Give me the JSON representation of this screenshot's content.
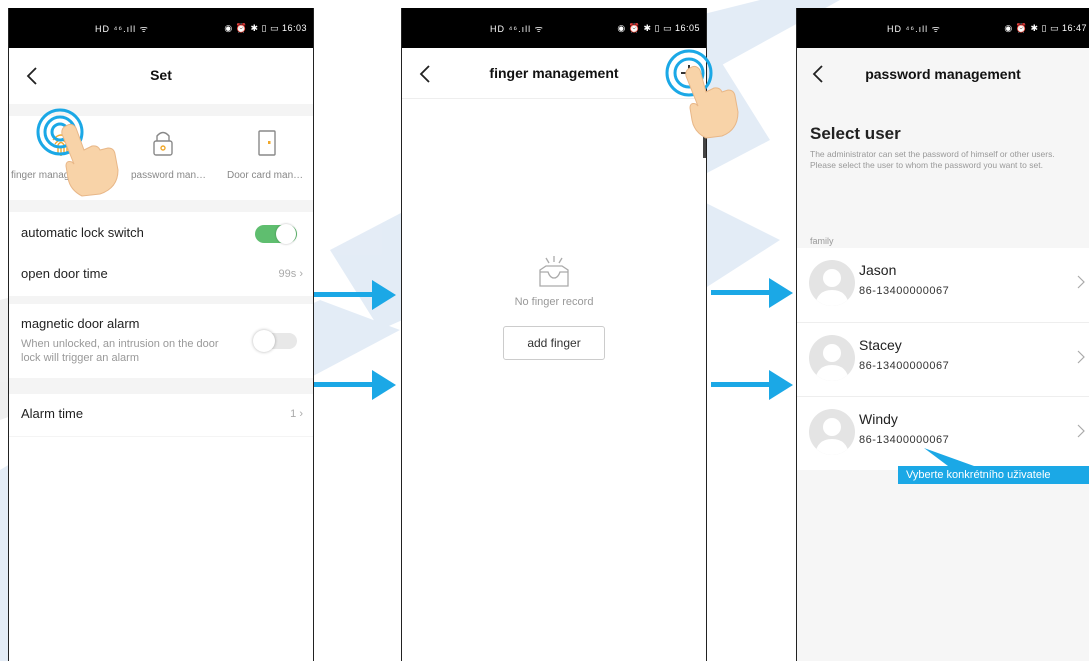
{
  "colors": {
    "accent": "#1ba8e6",
    "toggle_on": "#5fbe6f",
    "watermark": "#dce9f7"
  },
  "screen1": {
    "status_left": "HD ⁴⁶.ıll ᯤ",
    "status_right": "◉ ⏰ ✱ ▯ ▭ 16:03",
    "title": "Set",
    "icons": [
      {
        "label": "finger management",
        "icon": "fingerprint-icon"
      },
      {
        "label": "password management",
        "icon": "lock-icon"
      },
      {
        "label": "Door card management",
        "icon": "door-card-icon"
      }
    ],
    "automatic_lock": {
      "label": "automatic lock switch",
      "on": true
    },
    "open_door_time": {
      "label": "open door time",
      "value": "99s"
    },
    "magnetic_alarm": {
      "label": "magnetic door alarm",
      "description": "When unlocked, an intrusion on the door lock will trigger an alarm",
      "on": false
    },
    "alarm_time": {
      "label": "Alarm time",
      "value": "1"
    }
  },
  "screen2": {
    "status_left": "HD ⁴⁶.ıll ᯤ",
    "status_right": "◉ ⏰ ✱ ▯ ▭ 16:05",
    "title": "finger management",
    "empty_text": "No finger record",
    "add_button": "add finger"
  },
  "screen3": {
    "status_left": "HD ⁴⁶.ıll ᯤ",
    "status_right": "◉ ⏰ ✱ ▯ ▭ 16:47",
    "title": "password management",
    "heading": "Select user",
    "description": "The administrator can set the password of himself or other users. Please select the user to whom the password you want to set.",
    "group": "family",
    "users": [
      {
        "name": "Jason",
        "phone": "86-13400000067"
      },
      {
        "name": "Stacey",
        "phone": "86-13400000067"
      },
      {
        "name": "Windy",
        "phone": "86-13400000067"
      }
    ],
    "callout": "Vyberte konkrétního uživatele"
  }
}
